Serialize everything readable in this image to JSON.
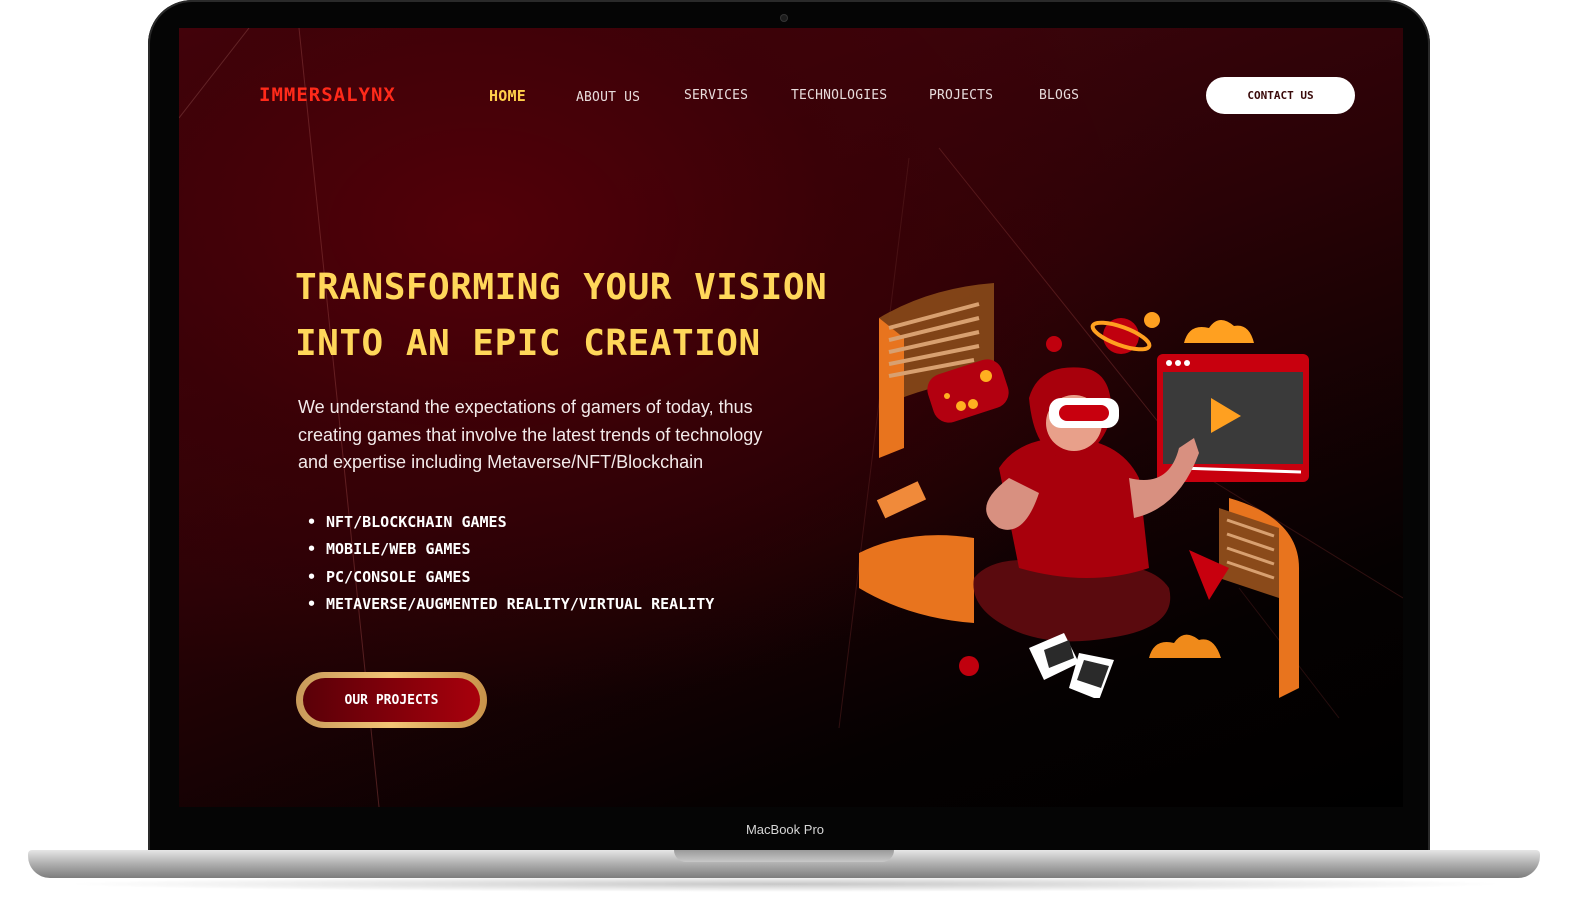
{
  "device": {
    "label": "MacBook Pro"
  },
  "nav": {
    "logo": "IMMERSALYNX",
    "items": [
      {
        "label": "HOME",
        "active": true
      },
      {
        "label": "ABOUT US",
        "active": false
      },
      {
        "label": "SERVICES",
        "active": false
      },
      {
        "label": "TECHNOLOGIES",
        "active": false
      },
      {
        "label": "PROJECTS",
        "active": false
      },
      {
        "label": "BLOGS",
        "active": false
      }
    ],
    "contact_label": "CONTACT US"
  },
  "hero": {
    "title_line1": "TRANSFORMING YOUR VISION",
    "title_line2": "INTO AN EPIC CREATION",
    "description_lines": [
      "We understand the expectations of gamers of today, thus",
      "creating games that involve the latest trends of technology",
      "and expertise including Metaverse/NFT/Blockchain"
    ],
    "bullets": [
      "NFT/BLOCKCHAIN GAMES",
      "MOBILE/WEB GAMES",
      "PC/CONSOLE GAMES",
      "METAVERSE/AUGMENTED REALITY/VIRTUAL REALITY"
    ],
    "cta_label": "OUR PROJECTS"
  },
  "colors": {
    "accent_yellow": "#ffd75a",
    "logo_red": "#ff2a1a",
    "button_red": "#a8000c",
    "bg_dark": "#2a0206"
  },
  "illustration": {
    "subject": "gamer-with-vr-headset"
  }
}
